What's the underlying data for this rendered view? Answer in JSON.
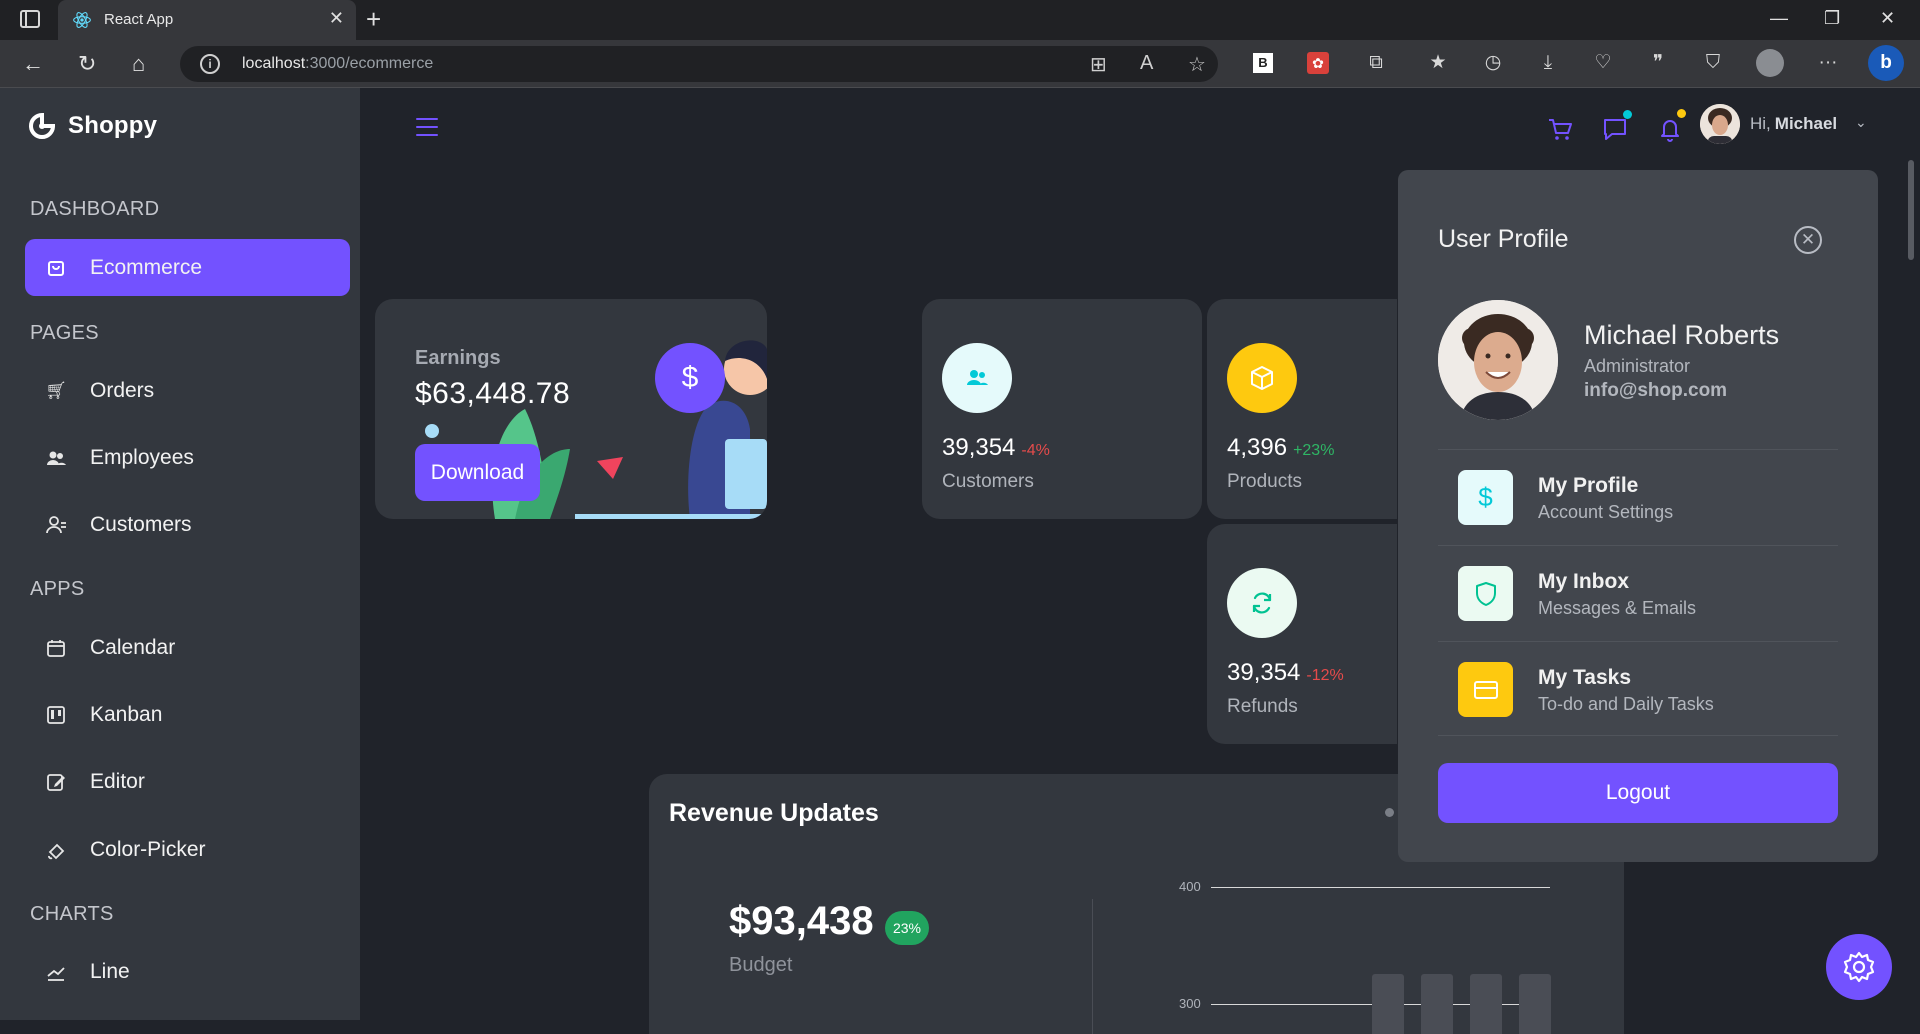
{
  "browser": {
    "tab_title": "React App",
    "url_host": "localhost",
    "url_path": ":3000/ecommerce"
  },
  "app": {
    "name": "Shoppy",
    "accent": "#7352ff"
  },
  "sidebar": {
    "sections": [
      {
        "title": "DASHBOARD",
        "items": [
          {
            "label": "Ecommerce",
            "icon": "shopping-bag-icon",
            "active": true
          }
        ]
      },
      {
        "title": "PAGES",
        "items": [
          {
            "label": "Orders",
            "icon": "cart-icon"
          },
          {
            "label": "Employees",
            "icon": "employees-icon"
          },
          {
            "label": "Customers",
            "icon": "customers-icon"
          }
        ]
      },
      {
        "title": "APPS",
        "items": [
          {
            "label": "Calendar",
            "icon": "calendar-icon"
          },
          {
            "label": "Kanban",
            "icon": "kanban-icon"
          },
          {
            "label": "Editor",
            "icon": "edit-icon"
          },
          {
            "label": "Color-Picker",
            "icon": "color-picker-icon"
          }
        ]
      },
      {
        "title": "CHARTS",
        "items": [
          {
            "label": "Line",
            "icon": "line-chart-icon"
          }
        ]
      }
    ]
  },
  "navbar": {
    "greeting": "Hi,",
    "user_first_name": "Michael"
  },
  "earnings": {
    "label": "Earnings",
    "value": "$63,448.78",
    "button": "Download",
    "currency_symbol": "$"
  },
  "stats": [
    {
      "value": "39,354",
      "change": "-4%",
      "label": "Customers",
      "change_color": "#e54b4b",
      "icon": "users-icon"
    },
    {
      "value": "4,396",
      "change": "+23%",
      "label": "Products",
      "change_color": "#2fb565",
      "icon": "box-icon"
    },
    {
      "value": "39,354",
      "change": "-12%",
      "label": "Refunds",
      "change_color": "#e54b4b",
      "icon": "refresh-icon"
    }
  ],
  "revenue": {
    "title": "Revenue Updates",
    "budget_value": "$93,438",
    "budget_badge": "23%",
    "budget_label": "Budget",
    "y_ticks": [
      "400",
      "300"
    ]
  },
  "profile": {
    "title": "User Profile",
    "name": "Michael Roberts",
    "role": "Administrator",
    "email": "info@shop.com",
    "items": [
      {
        "title": "My Profile",
        "subtitle": "Account Settings",
        "icon": "dollar-icon",
        "bg": "#e5fafb",
        "fg": "#03c9d7"
      },
      {
        "title": "My Inbox",
        "subtitle": "Messages & Emails",
        "icon": "shield-icon",
        "bg": "#ebfaf2",
        "fg": "#00c292"
      },
      {
        "title": "My Tasks",
        "subtitle": "To-do and Daily Tasks",
        "icon": "card-icon",
        "bg": "#fec90f",
        "fg": "#ffffff"
      }
    ],
    "logout": "Logout"
  }
}
